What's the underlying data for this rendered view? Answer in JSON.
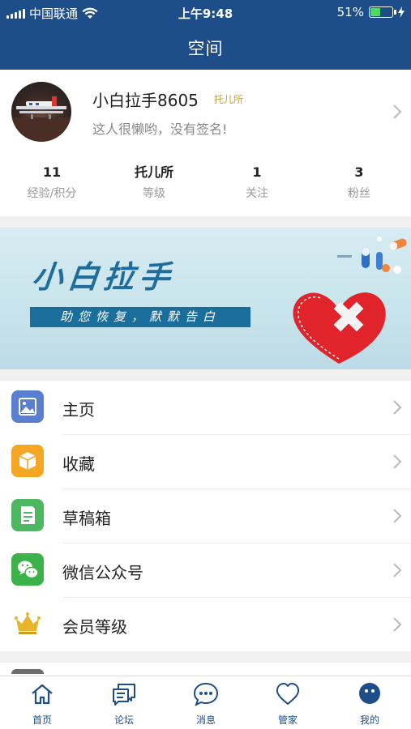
{
  "status_bar": {
    "carrier": "中国联通",
    "time": "上午9:48",
    "battery": "51%",
    "battery_level": 0.51
  },
  "header": {
    "title": "空间"
  },
  "profile": {
    "username": "小白拉手8605",
    "level_badge": "托儿所",
    "signature": "这人很懒哟，没有签名!",
    "stats": [
      {
        "value": "11",
        "label": "经验/积分"
      },
      {
        "value": "托儿所",
        "label": "等级"
      },
      {
        "value": "1",
        "label": "关注"
      },
      {
        "value": "3",
        "label": "粉丝"
      }
    ]
  },
  "banner": {
    "brand": "小白拉手",
    "slogan": "助您恢复，默默告白"
  },
  "menu": {
    "items": [
      {
        "label": "主页",
        "icon": "image-icon",
        "color": "#5b7fd0"
      },
      {
        "label": "收藏",
        "icon": "box-icon",
        "color": "#f5a623"
      },
      {
        "label": "草稿箱",
        "icon": "draft-icon",
        "color": "#4cb860"
      },
      {
        "label": "微信公众号",
        "icon": "wechat-icon",
        "color": "#3bb34a"
      },
      {
        "label": "会员等级",
        "icon": "crown-icon",
        "color": "#e8b52a"
      }
    ]
  },
  "tabbar": {
    "tabs": [
      {
        "label": "首页",
        "icon": "home-icon"
      },
      {
        "label": "论坛",
        "icon": "forum-icon"
      },
      {
        "label": "消息",
        "icon": "message-icon"
      },
      {
        "label": "管家",
        "icon": "heart-icon"
      },
      {
        "label": "我的",
        "icon": "profile-icon",
        "active": true
      }
    ],
    "color": "#1d4e89"
  }
}
